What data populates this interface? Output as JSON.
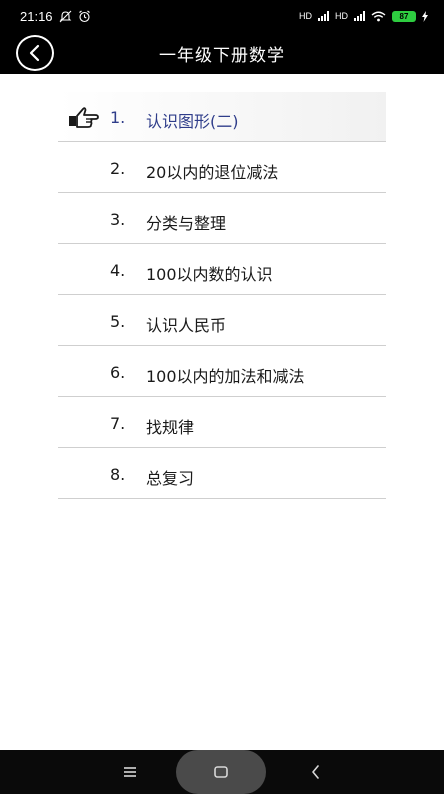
{
  "status_bar": {
    "time": "21:16",
    "icons": [
      "mute-bell-icon",
      "alarm-icon"
    ],
    "network_labels": [
      "HD",
      "HD"
    ],
    "battery_level": "87"
  },
  "header": {
    "back_icon": "chevron-left-icon",
    "title": "一年级下册数学"
  },
  "lessons": [
    {
      "num": "1.",
      "title": "认识图形(二)",
      "selected": true
    },
    {
      "num": "2.",
      "title": "20以内的退位减法",
      "selected": false
    },
    {
      "num": "3.",
      "title": "分类与整理",
      "selected": false
    },
    {
      "num": "4.",
      "title": "100以内数的认识",
      "selected": false
    },
    {
      "num": "5.",
      "title": "认识人民币",
      "selected": false
    },
    {
      "num": "6.",
      "title": "100以内的加法和减法",
      "selected": false
    },
    {
      "num": "7.",
      "title": "找规律",
      "selected": false
    },
    {
      "num": "8.",
      "title": "总复习",
      "selected": false
    }
  ],
  "colors": {
    "header_bg": "#000000",
    "selected_text": "#2f3d8a",
    "divider": "#cfcfcf"
  },
  "nav_bar": {
    "icons": [
      "menu-icon",
      "home-icon",
      "back-icon"
    ]
  }
}
